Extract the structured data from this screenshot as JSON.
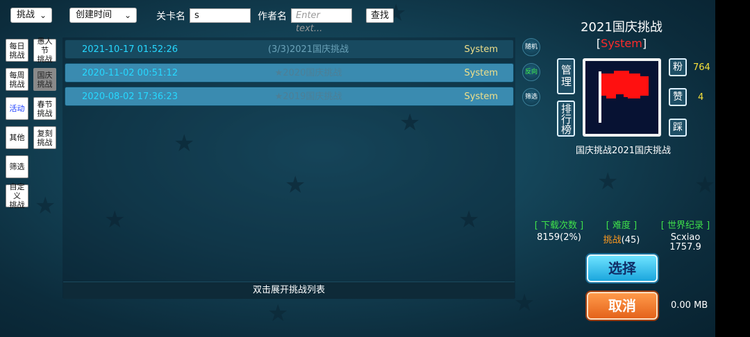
{
  "toolbar": {
    "mode_value": "挑战",
    "sort_value": "创建时间",
    "level_name_label": "关卡名",
    "level_name_value": "s",
    "author_label": "作者名",
    "author_placeholder": "Enter text...",
    "search_label": "查找"
  },
  "categories": [
    {
      "label": "每日\n挑战"
    },
    {
      "label": "愚人节\n挑战"
    },
    {
      "label": "每周\n挑战"
    },
    {
      "label": "国庆\n挑战",
      "active": true
    },
    {
      "label": "活动"
    },
    {
      "label": "春节\n挑战"
    },
    {
      "label": "其他"
    },
    {
      "label": "复刻\n挑战"
    },
    {
      "label": "筛选"
    },
    {
      "label": "自定义\n挑战"
    }
  ],
  "list": {
    "rows": [
      {
        "date": "2021-10-17 01:52:26",
        "title": "(3/3)2021国庆挑战",
        "author": "System"
      },
      {
        "date": "2020-11-02 00:51:12",
        "title": "★2020国庆挑战",
        "author": "System"
      },
      {
        "date": "2020-08-02 17:36:23",
        "title": "★2019国庆挑战",
        "author": "System"
      }
    ],
    "footer": "双击展开挑战列表"
  },
  "side_buttons": {
    "random": "随机",
    "reverse": "反向",
    "filter": "筛选"
  },
  "detail": {
    "title": "2021国庆挑战",
    "author_bracket_open": "[",
    "author": "System",
    "author_bracket_close": "]",
    "manage": "管理",
    "leaderboard": "排行榜",
    "fans_label": "粉",
    "fans_count": "764",
    "likes_label": "赞",
    "likes_count": "4",
    "dislike_label": "踩",
    "caption": "国庆挑战2021国庆挑战",
    "downloads_head": "[ 下载次数 ]",
    "downloads_value": "8159(2%)",
    "difficulty_head": "[ 难度 ]",
    "difficulty_word": "挑战",
    "difficulty_num": "(45)",
    "record_head": "[ 世界纪录 ]",
    "record_name": "Scxiao",
    "record_value": "1757.9",
    "select_label": "选择",
    "cancel_label": "取消",
    "size": "0.00 MB"
  },
  "colors": {
    "date": "#26d8ff",
    "author": "#f0e08a",
    "stat_head": "#3fe04a",
    "count": "#f6e03a",
    "flag": "#ff1010"
  }
}
